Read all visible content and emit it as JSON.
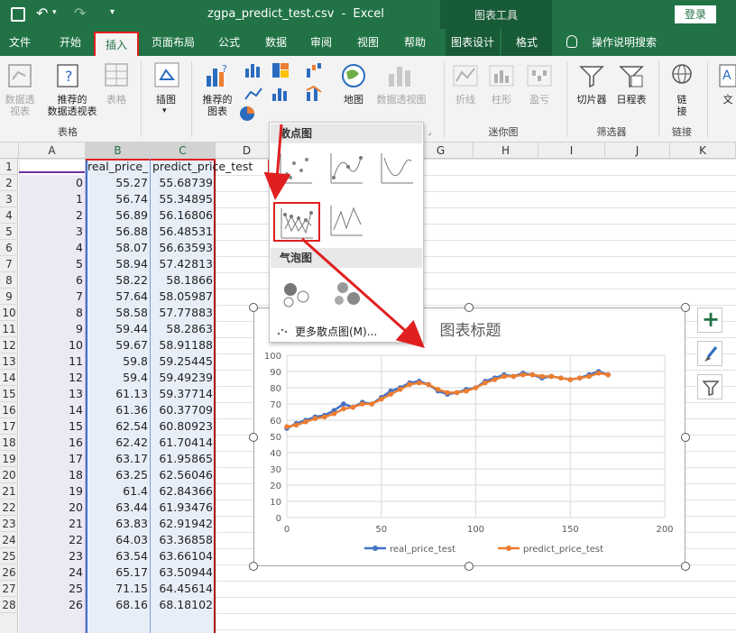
{
  "titlebar": {
    "filename": "zgpa_predict_test.csv",
    "separator": "-",
    "app": "Excel",
    "context_label": "图表工具",
    "login": "登录"
  },
  "tabs": [
    "文件",
    "开始",
    "插入",
    "页面布局",
    "公式",
    "数据",
    "审阅",
    "视图",
    "帮助",
    "图表设计",
    "格式"
  ],
  "tab_search": "操作说明搜索",
  "active_tab": "插入",
  "ribbon": {
    "pivot": "数据透\n视表",
    "rec_pivot": "推荐的\n数据透视表",
    "table": "表格",
    "group_table": "表格",
    "illustrations": "插图",
    "rec_charts": "推荐的\n图表",
    "maps": "地图",
    "pivot_chart": "数据透视图",
    "sparkline_line": "折线",
    "sparkline_col": "柱形",
    "sparkline_wl": "盈亏",
    "group_sparkline": "迷你图",
    "slicer": "切片器",
    "timeline": "日程表",
    "group_filter": "筛选器",
    "link": "链\n接",
    "group_link": "链接",
    "text": "文"
  },
  "columns": [
    "A",
    "B",
    "C",
    "D",
    "E",
    "F",
    "G",
    "H",
    "I",
    "J",
    "K"
  ],
  "cells": {
    "b1": "real_price_",
    "c1": "predict_price_test"
  },
  "rows": [
    {
      "n": "1",
      "a": "",
      "b": "",
      "c": ""
    },
    {
      "n": "2",
      "a": "0",
      "b": "55.27",
      "c": "55.68739"
    },
    {
      "n": "3",
      "a": "1",
      "b": "56.74",
      "c": "55.34895"
    },
    {
      "n": "4",
      "a": "2",
      "b": "56.89",
      "c": "56.16806"
    },
    {
      "n": "5",
      "a": "3",
      "b": "56.88",
      "c": "56.48531"
    },
    {
      "n": "6",
      "a": "4",
      "b": "58.07",
      "c": "56.63593"
    },
    {
      "n": "7",
      "a": "5",
      "b": "58.94",
      "c": "57.42813"
    },
    {
      "n": "8",
      "a": "6",
      "b": "58.22",
      "c": "58.1866"
    },
    {
      "n": "9",
      "a": "7",
      "b": "57.64",
      "c": "58.05987"
    },
    {
      "n": "10",
      "a": "8",
      "b": "58.58",
      "c": "57.77883"
    },
    {
      "n": "11",
      "a": "9",
      "b": "59.44",
      "c": "58.2863"
    },
    {
      "n": "12",
      "a": "10",
      "b": "59.67",
      "c": "58.91188"
    },
    {
      "n": "13",
      "a": "11",
      "b": "59.8",
      "c": "59.25445"
    },
    {
      "n": "14",
      "a": "12",
      "b": "59.4",
      "c": "59.49239"
    },
    {
      "n": "15",
      "a": "13",
      "b": "61.13",
      "c": "59.37714"
    },
    {
      "n": "16",
      "a": "14",
      "b": "61.36",
      "c": "60.37709"
    },
    {
      "n": "17",
      "a": "15",
      "b": "62.54",
      "c": "60.80923"
    },
    {
      "n": "18",
      "a": "16",
      "b": "62.42",
      "c": "61.70414"
    },
    {
      "n": "19",
      "a": "17",
      "b": "63.17",
      "c": "61.95865"
    },
    {
      "n": "20",
      "a": "18",
      "b": "63.25",
      "c": "62.56046"
    },
    {
      "n": "21",
      "a": "19",
      "b": "61.4",
      "c": "62.84366"
    },
    {
      "n": "22",
      "a": "20",
      "b": "63.44",
      "c": "61.93476"
    },
    {
      "n": "23",
      "a": "21",
      "b": "63.83",
      "c": "62.91942"
    },
    {
      "n": "24",
      "a": "22",
      "b": "64.03",
      "c": "63.36858"
    },
    {
      "n": "25",
      "a": "23",
      "b": "63.54",
      "c": "63.66104"
    },
    {
      "n": "26",
      "a": "24",
      "b": "65.17",
      "c": "63.50944"
    },
    {
      "n": "27",
      "a": "25",
      "b": "71.15",
      "c": "64.45614"
    },
    {
      "n": "28",
      "a": "26",
      "b": "68.16",
      "c": "68.18102"
    }
  ],
  "dropdown": {
    "scatter_header": "散点图",
    "bubble_header": "气泡图",
    "more": "更多散点图(M)..."
  },
  "colors": {
    "brand": "#217346",
    "highlight": "#e02020",
    "series1": "#4472c4",
    "series2": "#ed7d31"
  },
  "chart_data": {
    "type": "scatter",
    "title": "图表标题",
    "xlim": [
      0,
      200
    ],
    "ylim": [
      0,
      100
    ],
    "xticks": [
      0,
      50,
      100,
      150,
      200
    ],
    "yticks": [
      0,
      10,
      20,
      30,
      40,
      50,
      60,
      70,
      80,
      90,
      100
    ],
    "grid": true,
    "legend": "bottom",
    "series": [
      {
        "name": "real_price_test",
        "color": "#4472c4",
        "x": [
          0,
          5,
          10,
          15,
          20,
          25,
          30,
          35,
          40,
          45,
          50,
          55,
          60,
          65,
          70,
          75,
          80,
          85,
          90,
          95,
          100,
          105,
          110,
          115,
          120,
          125,
          130,
          135,
          140,
          145,
          150,
          155,
          160,
          165,
          170
        ],
        "y": [
          55,
          58,
          60,
          62,
          63,
          66,
          70,
          68,
          71,
          70,
          74,
          78,
          80,
          83,
          84,
          82,
          78,
          76,
          77,
          79,
          80,
          84,
          86,
          88,
          87,
          89,
          88,
          86,
          87,
          86,
          85,
          86,
          88,
          90,
          88
        ]
      },
      {
        "name": "predict_price_test",
        "color": "#ed7d31",
        "x": [
          0,
          5,
          10,
          15,
          20,
          25,
          30,
          35,
          40,
          45,
          50,
          55,
          60,
          65,
          70,
          75,
          80,
          85,
          90,
          95,
          100,
          105,
          110,
          115,
          120,
          125,
          130,
          135,
          140,
          145,
          150,
          155,
          160,
          165,
          170
        ],
        "y": [
          56,
          57,
          59,
          61,
          62,
          64,
          67,
          68,
          70,
          70,
          73,
          76,
          79,
          82,
          83,
          82,
          79,
          77,
          77,
          78,
          80,
          83,
          85,
          87,
          87,
          88,
          88,
          87,
          87,
          86,
          85,
          86,
          87,
          89,
          88
        ]
      }
    ]
  }
}
